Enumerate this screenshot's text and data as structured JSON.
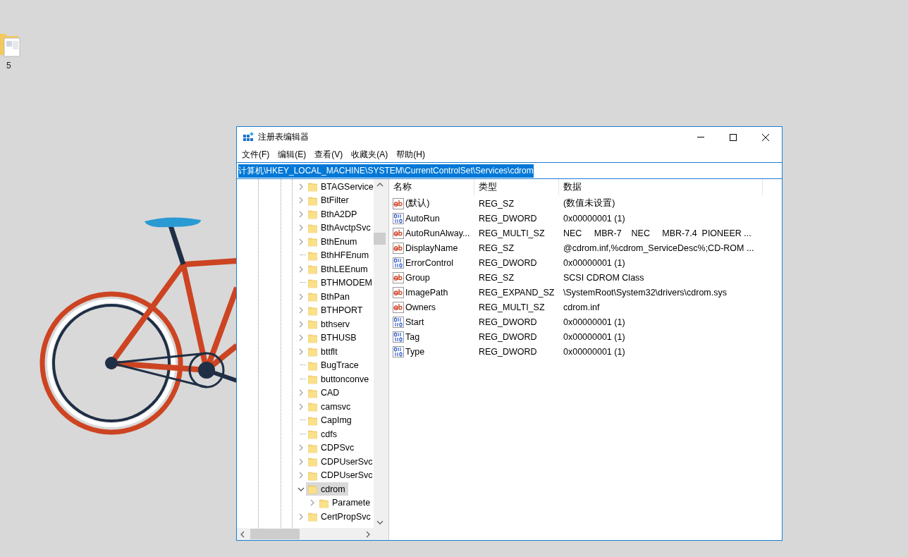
{
  "desktop": {
    "icons": [
      {
        "label": "5"
      }
    ]
  },
  "window": {
    "title": "注册表编辑器"
  },
  "menu": [
    "文件(F)",
    "编辑(E)",
    "查看(V)",
    "收藏夹(A)",
    "帮助(H)"
  ],
  "address": {
    "value": "计算机\\HKEY_LOCAL_MACHINE\\SYSTEM\\CurrentControlSet\\Services\\cdrom",
    "selected": true
  },
  "tree": [
    {
      "label": "BTAGService",
      "expandable": true,
      "expanded": false,
      "selected": false
    },
    {
      "label": "BtFilter",
      "expandable": true,
      "expanded": false,
      "selected": false
    },
    {
      "label": "BthA2DP",
      "expandable": true,
      "expanded": false,
      "selected": false
    },
    {
      "label": "BthAvctpSvc",
      "expandable": true,
      "expanded": false,
      "selected": false
    },
    {
      "label": "BthEnum",
      "expandable": true,
      "expanded": false,
      "selected": false
    },
    {
      "label": "BthHFEnum",
      "expandable": false,
      "selected": false
    },
    {
      "label": "BthLEEnum",
      "expandable": true,
      "expanded": false,
      "selected": false
    },
    {
      "label": "BTHMODEM",
      "expandable": false,
      "selected": false
    },
    {
      "label": "BthPan",
      "expandable": true,
      "expanded": false,
      "selected": false
    },
    {
      "label": "BTHPORT",
      "expandable": true,
      "expanded": false,
      "selected": false
    },
    {
      "label": "bthserv",
      "expandable": true,
      "expanded": false,
      "selected": false
    },
    {
      "label": "BTHUSB",
      "expandable": true,
      "expanded": false,
      "selected": false
    },
    {
      "label": "bttflt",
      "expandable": true,
      "expanded": false,
      "selected": false
    },
    {
      "label": "BugTrace",
      "expandable": false,
      "selected": false
    },
    {
      "label": "buttonconve",
      "expandable": false,
      "selected": false
    },
    {
      "label": "CAD",
      "expandable": true,
      "expanded": false,
      "selected": false
    },
    {
      "label": "camsvc",
      "expandable": true,
      "expanded": false,
      "selected": false
    },
    {
      "label": "CapImg",
      "expandable": false,
      "selected": false
    },
    {
      "label": "cdfs",
      "expandable": false,
      "selected": false
    },
    {
      "label": "CDPSvc",
      "expandable": true,
      "expanded": false,
      "selected": false
    },
    {
      "label": "CDPUserSvc",
      "expandable": true,
      "expanded": false,
      "selected": false
    },
    {
      "label": "CDPUserSvc",
      "expandable": true,
      "expanded": false,
      "selected": false
    },
    {
      "label": "cdrom",
      "expandable": true,
      "expanded": true,
      "selected": true,
      "children": [
        {
          "label": "Paramete",
          "expandable": true,
          "expanded": false,
          "selected": false
        }
      ]
    },
    {
      "label": "CertPropSvc",
      "expandable": true,
      "expanded": false,
      "selected": false
    }
  ],
  "values": {
    "columns": [
      "名称",
      "类型",
      "数据"
    ],
    "rows": [
      {
        "kind": "string",
        "name": "(默认)",
        "type": "REG_SZ",
        "data": "(数值未设置)"
      },
      {
        "kind": "binary",
        "name": "AutoRun",
        "type": "REG_DWORD",
        "data": "0x00000001 (1)"
      },
      {
        "kind": "string",
        "name": "AutoRunAlway...",
        "type": "REG_MULTI_SZ",
        "data": "NEC     MBR-7    NEC     MBR-7.4  PIONEER ..."
      },
      {
        "kind": "string",
        "name": "DisplayName",
        "type": "REG_SZ",
        "data": "@cdrom.inf,%cdrom_ServiceDesc%;CD-ROM ..."
      },
      {
        "kind": "binary",
        "name": "ErrorControl",
        "type": "REG_DWORD",
        "data": "0x00000001 (1)"
      },
      {
        "kind": "string",
        "name": "Group",
        "type": "REG_SZ",
        "data": "SCSI CDROM Class"
      },
      {
        "kind": "string",
        "name": "ImagePath",
        "type": "REG_EXPAND_SZ",
        "data": "\\SystemRoot\\System32\\drivers\\cdrom.sys"
      },
      {
        "kind": "string",
        "name": "Owners",
        "type": "REG_MULTI_SZ",
        "data": "cdrom.inf"
      },
      {
        "kind": "binary",
        "name": "Start",
        "type": "REG_DWORD",
        "data": "0x00000001 (1)"
      },
      {
        "kind": "binary",
        "name": "Tag",
        "type": "REG_DWORD",
        "data": "0x00000001 (1)"
      },
      {
        "kind": "binary",
        "name": "Type",
        "type": "REG_DWORD",
        "data": "0x00000001 (1)"
      }
    ]
  }
}
